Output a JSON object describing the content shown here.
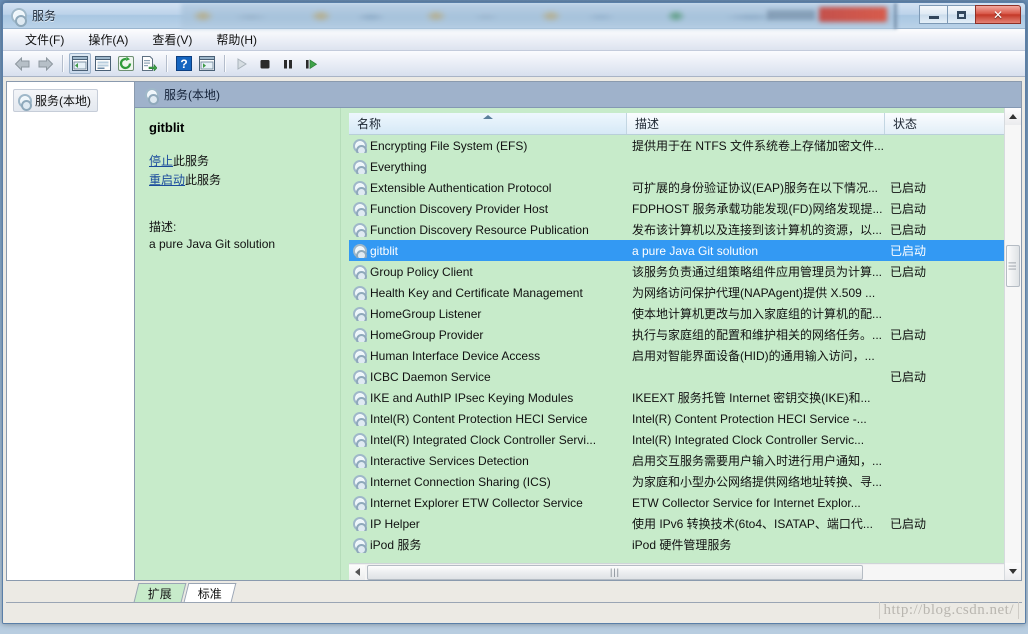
{
  "window": {
    "title": "服务",
    "icon": "services-gear-icon",
    "buttons": {
      "minimize": "最小化",
      "maximize": "最大化",
      "close": "关闭"
    }
  },
  "menubar": {
    "items": [
      {
        "label": "文件(F)",
        "name": "menu-file"
      },
      {
        "label": "操作(A)",
        "name": "menu-action"
      },
      {
        "label": "查看(V)",
        "name": "menu-view"
      },
      {
        "label": "帮助(H)",
        "name": "menu-help"
      }
    ]
  },
  "toolbar": {
    "buttons": [
      {
        "name": "back-icon",
        "glyph": "◀"
      },
      {
        "name": "forward-icon",
        "glyph": "▶"
      },
      {
        "name": "show-hide-tree-icon",
        "glyph": "▤"
      },
      {
        "name": "properties-icon",
        "glyph": "▥"
      },
      {
        "name": "refresh-icon",
        "glyph": "↻"
      },
      {
        "name": "export-list-icon",
        "glyph": "⇥"
      },
      {
        "name": "help-icon",
        "glyph": "?"
      },
      {
        "name": "show-action-pane-icon",
        "glyph": "▦"
      },
      {
        "name": "start-service-icon",
        "glyph": "▶"
      },
      {
        "name": "stop-service-icon",
        "glyph": "■"
      },
      {
        "name": "pause-service-icon",
        "glyph": "❚❚"
      },
      {
        "name": "restart-service-icon",
        "glyph": "❚▶"
      }
    ]
  },
  "tree": {
    "root_label": "服务(本地)"
  },
  "pane": {
    "header_label": "服务(本地)"
  },
  "details": {
    "service_name": "gitblit",
    "stop_link": "停止",
    "stop_suffix": "此服务",
    "restart_link": "重启动",
    "restart_suffix": "此服务",
    "description_label": "描述:",
    "description_text": "a pure Java Git solution"
  },
  "list": {
    "columns": [
      {
        "label": "名称",
        "name": "column-name",
        "sorted": "asc"
      },
      {
        "label": "描述",
        "name": "column-description"
      },
      {
        "label": "状态",
        "name": "column-status"
      }
    ],
    "rows": [
      {
        "name": "Encrypting File System (EFS)",
        "description": "提供用于在 NTFS 文件系统卷上存储加密文件...",
        "status": ""
      },
      {
        "name": "Everything",
        "description": "",
        "status": ""
      },
      {
        "name": "Extensible Authentication Protocol",
        "description": "可扩展的身份验证协议(EAP)服务在以下情况...",
        "status": "已启动"
      },
      {
        "name": "Function Discovery Provider Host",
        "description": "FDPHOST 服务承载功能发现(FD)网络发现提...",
        "status": "已启动"
      },
      {
        "name": "Function Discovery Resource Publication",
        "description": "发布该计算机以及连接到该计算机的资源，以...",
        "status": "已启动"
      },
      {
        "name": "gitblit",
        "description": "a pure Java Git solution",
        "status": "已启动",
        "selected": true
      },
      {
        "name": "Group Policy Client",
        "description": "该服务负责通过组策略组件应用管理员为计算...",
        "status": "已启动"
      },
      {
        "name": "Health Key and Certificate Management",
        "description": "为网络访问保护代理(NAPAgent)提供 X.509 ...",
        "status": ""
      },
      {
        "name": "HomeGroup Listener",
        "description": "使本地计算机更改与加入家庭组的计算机的配...",
        "status": ""
      },
      {
        "name": "HomeGroup Provider",
        "description": "执行与家庭组的配置和维护相关的网络任务。...",
        "status": "已启动"
      },
      {
        "name": "Human Interface Device Access",
        "description": "启用对智能界面设备(HID)的通用输入访问，...",
        "status": ""
      },
      {
        "name": "ICBC Daemon Service",
        "description": "",
        "status": "已启动"
      },
      {
        "name": "IKE and AuthIP IPsec Keying Modules",
        "description": "IKEEXT 服务托管 Internet 密钥交换(IKE)和...",
        "status": ""
      },
      {
        "name": "Intel(R) Content Protection HECI Service",
        "description": "Intel(R) Content Protection HECI Service -...",
        "status": ""
      },
      {
        "name": "Intel(R) Integrated Clock Controller Servi...",
        "description": "Intel(R) Integrated Clock Controller Servic...",
        "status": ""
      },
      {
        "name": "Interactive Services Detection",
        "description": "启用交互服务需要用户输入时进行用户通知，...",
        "status": ""
      },
      {
        "name": "Internet Connection Sharing (ICS)",
        "description": "为家庭和小型办公网络提供网络地址转换、寻...",
        "status": ""
      },
      {
        "name": "Internet Explorer ETW Collector Service",
        "description": "ETW Collector Service for Internet Explor...",
        "status": ""
      },
      {
        "name": "IP Helper",
        "description": "使用 IPv6 转换技术(6to4、ISATAP、端口代...",
        "status": "已启动"
      },
      {
        "name": "iPod 服务",
        "description": "iPod 硬件管理服务",
        "status": ""
      }
    ]
  },
  "tabs": [
    {
      "label": "扩展",
      "name": "tab-extended",
      "active": true
    },
    {
      "label": "标准",
      "name": "tab-standard",
      "active": false
    }
  ],
  "watermark": {
    "text": "http://blog.csdn.net/"
  },
  "colors": {
    "list_background": "#c7ebca",
    "selection": "#3399f3",
    "pane_header": "#9fb2cb",
    "link": "#1a4b9c"
  }
}
